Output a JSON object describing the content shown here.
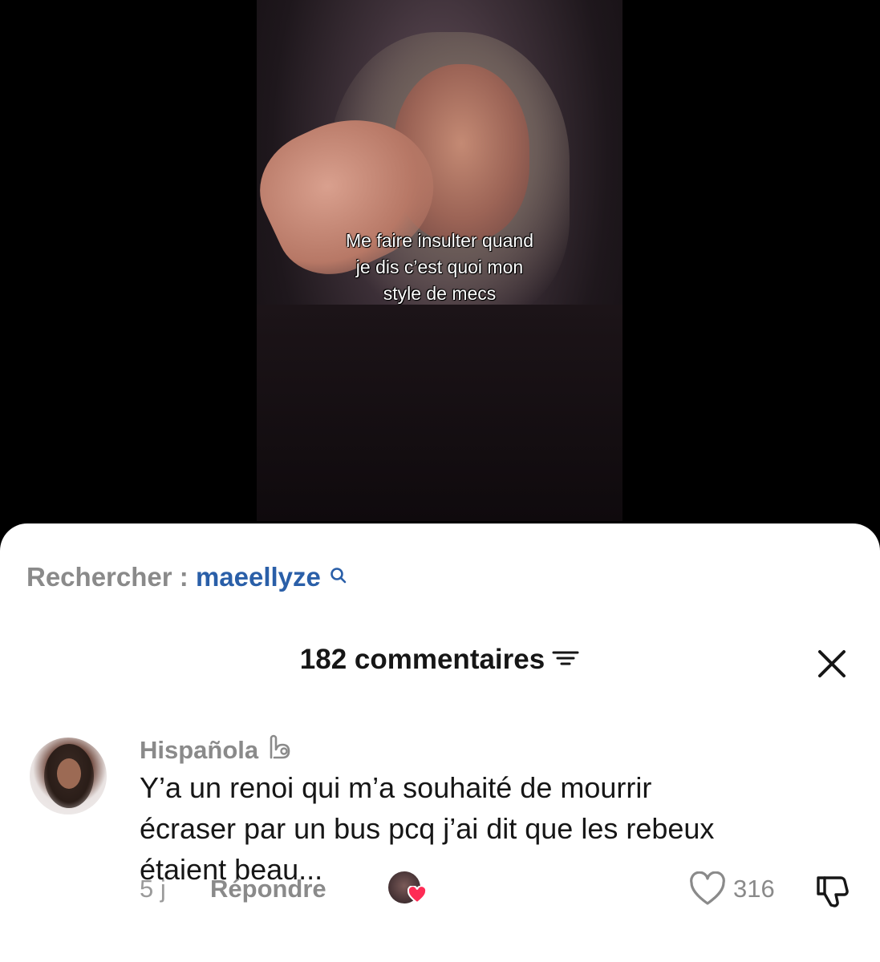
{
  "video": {
    "caption_lines": [
      "Me faire insulter quand",
      "je dis c’est quoi mon",
      "style de mecs"
    ]
  },
  "search": {
    "prefix": "Rechercher :",
    "term": "maeellyze",
    "icon": "search-icon"
  },
  "comments_header": {
    "count_label": "182 commentaires",
    "filter_icon": "filter-icon",
    "close_icon": "close-icon"
  },
  "comment": {
    "username": "Hispañola",
    "badge_icon": "creator-liked-icon",
    "text_lines": [
      "Y’a un renoi qui m’a souhaité de mourrir",
      "écraser par un bus pcq j’ai dit que les rebeux",
      "étaient beau..."
    ],
    "timestamp": "5 j",
    "reply_label": "Répondre",
    "like_count": "316"
  },
  "colors": {
    "search_term": "#2a5fa8",
    "muted": "#8a8a8a",
    "text": "#161616",
    "heart": "#fe2c55"
  }
}
